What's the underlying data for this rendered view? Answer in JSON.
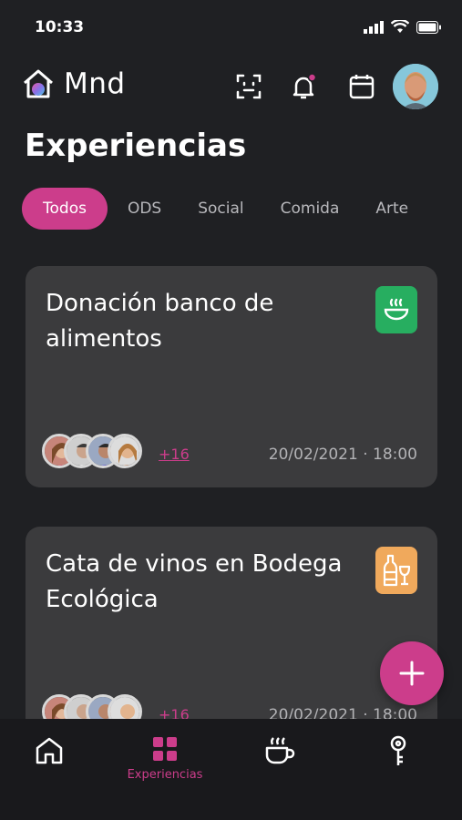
{
  "status": {
    "time": "10:33"
  },
  "header": {
    "app_name": "Mnd"
  },
  "page": {
    "title": "Experiencias"
  },
  "tabs": [
    {
      "label": "Todos",
      "active": true
    },
    {
      "label": "ODS"
    },
    {
      "label": "Social"
    },
    {
      "label": "Comida"
    },
    {
      "label": "Arte"
    }
  ],
  "cards": [
    {
      "title": "Donación banco de alimentos",
      "icon": "food-bowl-icon",
      "icon_color": "#27ae60",
      "more": "+16",
      "date": "20/02/2021",
      "time": "18:00"
    },
    {
      "title": "Cata de vinos en Bodega Ecológica",
      "icon": "wine-icon",
      "icon_color": "#f0a95c",
      "more": "+16",
      "date": "20/02/2021",
      "time": "18:00"
    }
  ],
  "nav": [
    {
      "icon": "home-icon"
    },
    {
      "icon": "grid-icon",
      "label": "Experiencias",
      "active": true
    },
    {
      "icon": "coffee-icon"
    },
    {
      "icon": "key-icon"
    }
  ],
  "colors": {
    "accent": "#cc3d8b",
    "background": "#1f2023",
    "card": "#3b3b3d"
  }
}
